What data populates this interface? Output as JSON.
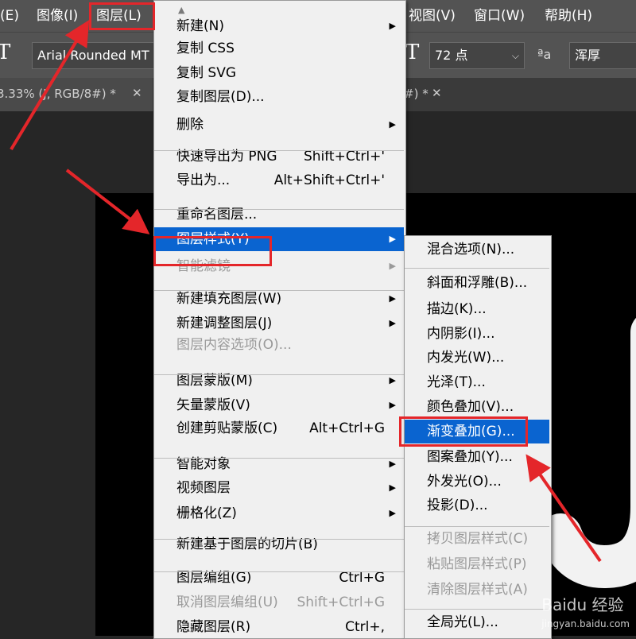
{
  "menubar": {
    "items": [
      "(E)",
      "图像(I)",
      "图层(L)",
      "视图(V)",
      "窗口(W)",
      "帮助(H)"
    ]
  },
  "options": {
    "font_family": "Arial Rounded MT B...",
    "font_size": "72 点",
    "aa_label": "ªa",
    "aa_method": "浑厚"
  },
  "tabs": {
    "left": "3.33% (J, RGB/8#) *",
    "right": "#) *"
  },
  "layer_menu": {
    "items": [
      {
        "label": "新建(N)",
        "shortcut": "",
        "submenu": true,
        "disabled": false
      },
      {
        "label": "复制 CSS",
        "shortcut": "",
        "submenu": false,
        "disabled": false
      },
      {
        "label": "复制 SVG",
        "shortcut": "",
        "submenu": false,
        "disabled": false
      },
      {
        "label": "复制图层(D)...",
        "shortcut": "",
        "submenu": false,
        "disabled": false
      },
      {
        "label": "删除",
        "shortcut": "",
        "submenu": true,
        "disabled": false
      },
      {
        "label": "快速导出为 PNG",
        "shortcut": "Shift+Ctrl+'",
        "submenu": false,
        "disabled": false
      },
      {
        "label": "导出为...",
        "shortcut": "Alt+Shift+Ctrl+'",
        "submenu": false,
        "disabled": false
      },
      {
        "label": "重命名图层...",
        "shortcut": "",
        "submenu": false,
        "disabled": false
      },
      {
        "label": "图层样式(Y)",
        "shortcut": "",
        "submenu": true,
        "disabled": false
      },
      {
        "label": "智能滤镜",
        "shortcut": "",
        "submenu": true,
        "disabled": true
      },
      {
        "label": "新建填充图层(W)",
        "shortcut": "",
        "submenu": true,
        "disabled": false
      },
      {
        "label": "新建调整图层(J)",
        "shortcut": "",
        "submenu": true,
        "disabled": false
      },
      {
        "label": "图层内容选项(O)...",
        "shortcut": "",
        "submenu": false,
        "disabled": true
      },
      {
        "label": "图层蒙版(M)",
        "shortcut": "",
        "submenu": true,
        "disabled": false
      },
      {
        "label": "矢量蒙版(V)",
        "shortcut": "",
        "submenu": true,
        "disabled": false
      },
      {
        "label": "创建剪贴蒙版(C)",
        "shortcut": "Alt+Ctrl+G",
        "submenu": false,
        "disabled": false
      },
      {
        "label": "智能对象",
        "shortcut": "",
        "submenu": true,
        "disabled": false
      },
      {
        "label": "视频图层",
        "shortcut": "",
        "submenu": true,
        "disabled": false
      },
      {
        "label": "栅格化(Z)",
        "shortcut": "",
        "submenu": true,
        "disabled": false
      },
      {
        "label": "新建基于图层的切片(B)",
        "shortcut": "",
        "submenu": false,
        "disabled": false
      },
      {
        "label": "图层编组(G)",
        "shortcut": "Ctrl+G",
        "submenu": false,
        "disabled": false
      },
      {
        "label": "取消图层编组(U)",
        "shortcut": "Shift+Ctrl+G",
        "submenu": false,
        "disabled": true
      },
      {
        "label": "隐藏图层(R)",
        "shortcut": "Ctrl+,",
        "submenu": false,
        "disabled": false
      }
    ]
  },
  "style_submenu": {
    "items": [
      {
        "label": "混合选项(N)...",
        "disabled": false
      },
      {
        "label": "斜面和浮雕(B)...",
        "disabled": false
      },
      {
        "label": "描边(K)...",
        "disabled": false
      },
      {
        "label": "内阴影(I)...",
        "disabled": false
      },
      {
        "label": "内发光(W)...",
        "disabled": false
      },
      {
        "label": "光泽(T)...",
        "disabled": false
      },
      {
        "label": "颜色叠加(V)...",
        "disabled": false
      },
      {
        "label": "渐变叠加(G)...",
        "disabled": false
      },
      {
        "label": "图案叠加(Y)...",
        "disabled": false
      },
      {
        "label": "外发光(O)...",
        "disabled": false
      },
      {
        "label": "投影(D)...",
        "disabled": false
      },
      {
        "label": "拷贝图层样式(C)",
        "disabled": true
      },
      {
        "label": "粘贴图层样式(P)",
        "disabled": true
      },
      {
        "label": "清除图层样式(A)",
        "disabled": true
      },
      {
        "label": "全局光(L)...",
        "disabled": false
      }
    ]
  },
  "watermark": {
    "text": "Baidu 经验",
    "url": "jingyan.baidu.com"
  },
  "colors": {
    "highlight": "#0a64d0",
    "annotation_red": "#e4262a"
  }
}
